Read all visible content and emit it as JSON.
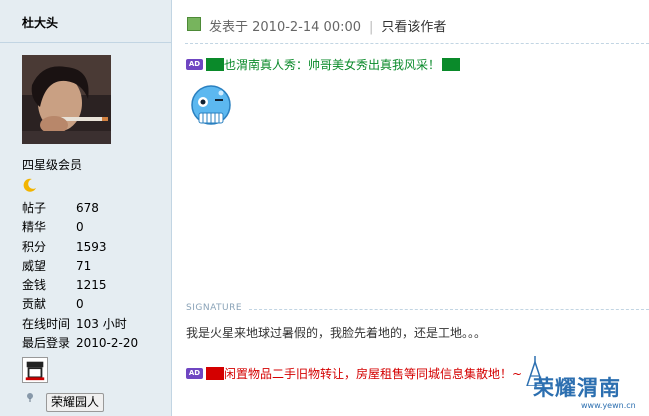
{
  "user": {
    "name": "杜大头",
    "rank": "四星级会员",
    "stats": [
      {
        "label": "帖子",
        "value": "678"
      },
      {
        "label": "精华",
        "value": "0"
      },
      {
        "label": "积分",
        "value": "1593"
      },
      {
        "label": "威望",
        "value": "71"
      },
      {
        "label": "金钱",
        "value": "1215"
      },
      {
        "label": "贡献",
        "value": "0"
      },
      {
        "label": "在线时间",
        "value": "103 小时"
      },
      {
        "label": "最后登录",
        "value": "2010-2-20"
      }
    ],
    "medal_label": "荣耀园人"
  },
  "post": {
    "posted_at": "发表于 2010-2-14 00:00",
    "only_author": "只看该作者",
    "ad_badge": "AD",
    "ad1_text": "也渭南真人秀：帅哥美女秀出真我风采！",
    "signature_label": "SIGNATURE",
    "signature_text": "我是火星来地球过暑假的，我脸先着地的，还是工地。。。",
    "ad2_text": "闲置物品二手旧物转让，房屋租售等同城信息集散地！~"
  },
  "logo": {
    "main": "荣耀渭南",
    "url": "www.yewn.cn"
  },
  "colors": {
    "sidebar_bg": "#e5edf2",
    "ad1_green": "#0a8a2a",
    "ad2_red": "#d40000",
    "badge_purple": "#6f46c2",
    "logo_blue": "#2c6fb0"
  }
}
